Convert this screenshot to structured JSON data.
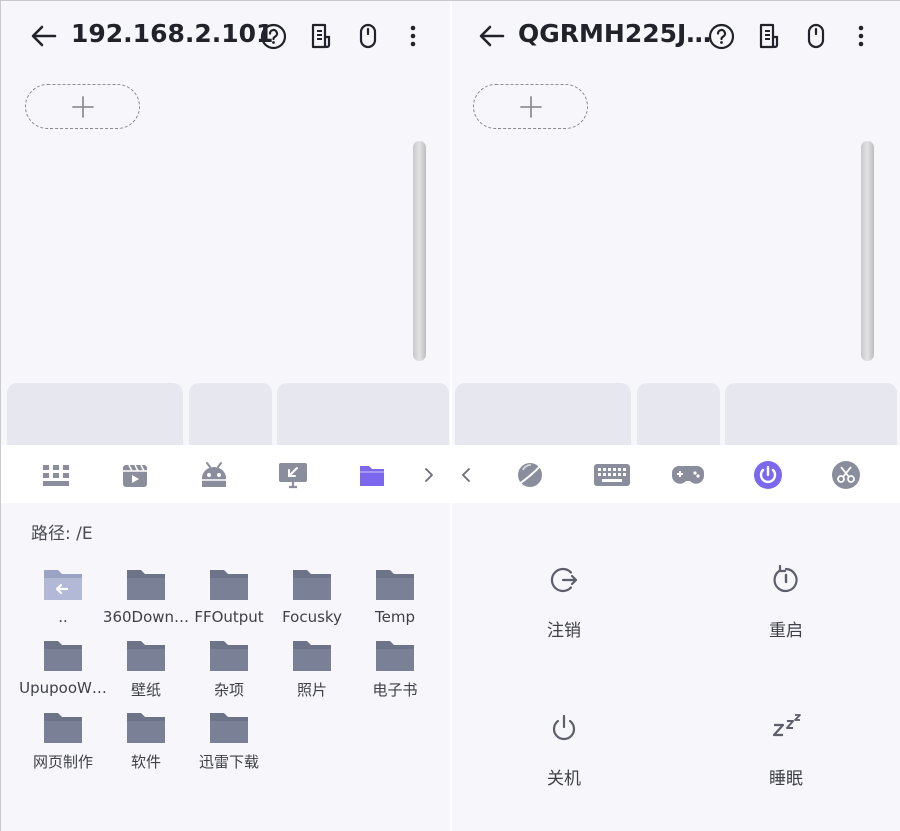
{
  "left_panel": {
    "title": "192.168.2.101",
    "path_label": "路径: /E",
    "files": [
      {
        "name": ".."
      },
      {
        "name": "360Down…"
      },
      {
        "name": "FFOutput"
      },
      {
        "name": "Focusky"
      },
      {
        "name": "Temp"
      },
      {
        "name": "UpupooW…"
      },
      {
        "name": "壁纸"
      },
      {
        "name": "杂项"
      },
      {
        "name": "照片"
      },
      {
        "name": "电子书"
      },
      {
        "name": "网页制作"
      },
      {
        "name": "软件"
      },
      {
        "name": "迅雷下载"
      }
    ],
    "toolbar_icons": [
      "grid-icon",
      "video-icon",
      "android-icon",
      "screen-cast-icon",
      "folder-icon",
      "chevron-right-icon"
    ],
    "selected_tool": "folder-icon"
  },
  "right_panel": {
    "title": "QGRMH225J…",
    "toolbar_icons": [
      "chevron-left-icon",
      "planet-icon",
      "keyboard-icon",
      "gamepad-icon",
      "power-icon",
      "scissors-icon"
    ],
    "selected_tool": "power-icon",
    "power_options": [
      {
        "label": "注销",
        "icon": "logout-icon"
      },
      {
        "label": "重启",
        "icon": "restart-icon"
      },
      {
        "label": "关机",
        "icon": "shutdown-icon"
      },
      {
        "label": "睡眠",
        "icon": "sleep-icon"
      }
    ]
  },
  "header_icons": [
    "help-icon",
    "document-icon",
    "mouse-icon",
    "more-vert-icon"
  ],
  "colors": {
    "accent": "#7b68ee",
    "icon_gray": "#8a8d9c",
    "folder": "#6d7389",
    "text_dark": "#22222a",
    "background": "#f6f6fb",
    "key": "#e7e8ef"
  }
}
